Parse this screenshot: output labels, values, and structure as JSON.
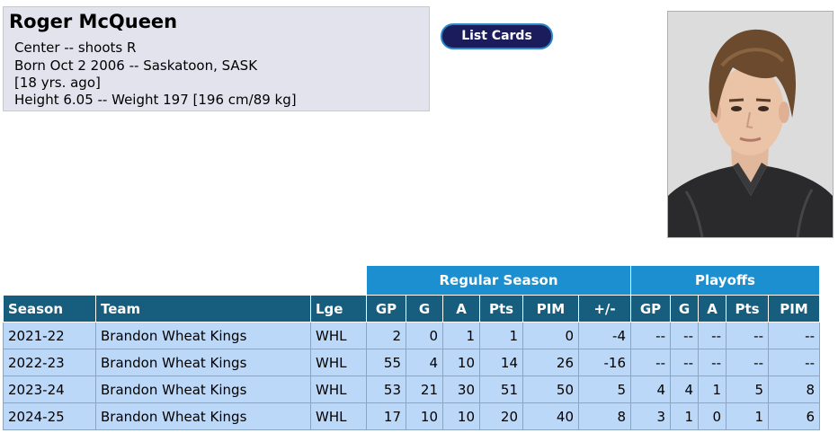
{
  "player": {
    "name": "Roger McQueen",
    "position_line": "Center -- shoots R",
    "born_line": "Born Oct 2 2006 -- Saskatoon, SASK",
    "age_line": "[18 yrs. ago]",
    "size_line": "Height 6.05 -- Weight 197 [196 cm/89 kg]"
  },
  "buttons": {
    "list_cards": "List Cards"
  },
  "photo": {
    "icon": "player-headshot"
  },
  "stats": {
    "groups": {
      "regular": "Regular Season",
      "playoffs": "Playoffs"
    },
    "headers": {
      "season": "Season",
      "team": "Team",
      "lge": "Lge",
      "rs_gp": "GP",
      "rs_g": "G",
      "rs_a": "A",
      "rs_pts": "Pts",
      "rs_pim": "PIM",
      "rs_pm": "+/-",
      "po_gp": "GP",
      "po_g": "G",
      "po_a": "A",
      "po_pts": "Pts",
      "po_pim": "PIM"
    },
    "rows": [
      {
        "season": "2021-22",
        "team": "Brandon Wheat Kings",
        "lge": "WHL",
        "gp": "2",
        "g": "0",
        "a": "1",
        "pts": "1",
        "pim": "0",
        "pm": "-4",
        "pgp": "--",
        "pg": "--",
        "pa": "--",
        "ppts": "--",
        "ppim": "--"
      },
      {
        "season": "2022-23",
        "team": "Brandon Wheat Kings",
        "lge": "WHL",
        "gp": "55",
        "g": "4",
        "a": "10",
        "pts": "14",
        "pim": "26",
        "pm": "-16",
        "pgp": "--",
        "pg": "--",
        "pa": "--",
        "ppts": "--",
        "ppim": "--"
      },
      {
        "season": "2023-24",
        "team": "Brandon Wheat Kings",
        "lge": "WHL",
        "gp": "53",
        "g": "21",
        "a": "30",
        "pts": "51",
        "pim": "50",
        "pm": "5",
        "pgp": "4",
        "pg": "4",
        "pa": "1",
        "ppts": "5",
        "ppim": "8"
      },
      {
        "season": "2024-25",
        "team": "Brandon Wheat Kings",
        "lge": "WHL",
        "gp": "17",
        "g": "10",
        "a": "10",
        "pts": "20",
        "pim": "40",
        "pm": "8",
        "pgp": "3",
        "pg": "1",
        "pa": "0",
        "ppts": "1",
        "ppim": "6"
      }
    ]
  },
  "colors": {
    "group_header": "#1b8fd0",
    "column_header": "#175d7e",
    "row_bg": "#bcd8f8",
    "bio_bg": "#e3e3ee",
    "button_bg": "#1a1c5c"
  }
}
